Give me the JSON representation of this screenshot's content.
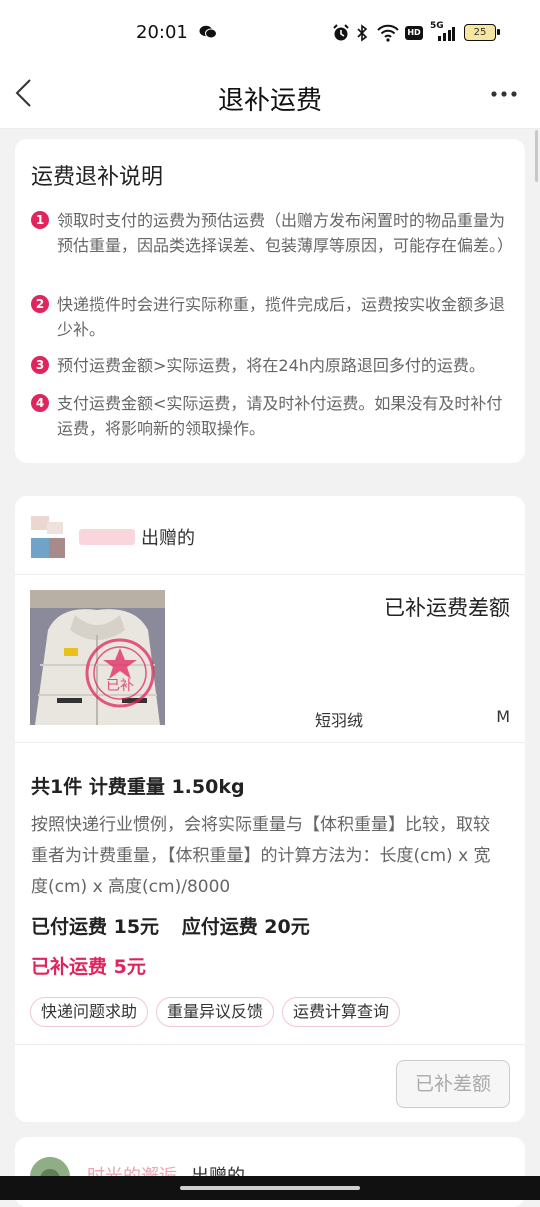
{
  "status_bar": {
    "time": "20:01",
    "network": "5G",
    "hd": "HD",
    "battery": "25",
    "icons": [
      "wechat-icon",
      "alarm-icon",
      "bluetooth-icon",
      "wifi-icon",
      "hd-icon",
      "signal-icon",
      "battery-icon"
    ]
  },
  "nav": {
    "title": "退补运费",
    "back_icon": "chevron-left-icon",
    "more_icon": "more-dots-icon"
  },
  "explain": {
    "title": "运费退补说明",
    "rules": [
      {
        "num": "1",
        "text": "领取时支付的运费为预估运费（出赠方发布闲置时的物品重量为预估重量，因品类选择误差、包装薄厚等原因，可能存在偏差。）"
      },
      {
        "num": "2",
        "text": "快递揽件时会进行实际称重，揽件完成后，运费按实收金额多退少补。"
      },
      {
        "num": "3",
        "text": "预付运费金额>实际运费，将在24h内原路退回多付的运费。"
      },
      {
        "num": "4",
        "text": "支付运费金额<实际运费，请及时补付运费。如果没有及时补付运费，将影响新的领取操作。"
      }
    ]
  },
  "order": {
    "giver_suffix": "出赠的",
    "status": "已补运费差额",
    "stamp_text": "已补",
    "item_name": "短羽绒",
    "item_size": "M",
    "count_weight": "共1件 计费重量 1.50kg",
    "desc": "按照快递行业惯例，会将实际重量与【体积重量】比较，取较重者为计费重量，【体积重量】的计算方法为：长度(cm) x 宽度(cm) x 高度(cm)/8000",
    "paid": "已付运费 15元",
    "due": "应付运费 20元",
    "diff": "已补运费 5元",
    "chips": [
      "快递问题求助",
      "重量异议反馈",
      "运费计算查询"
    ],
    "action": "已补差额"
  },
  "next_order": {
    "giver_name": "时光的邂逅",
    "giver_suffix": "出赠的"
  },
  "colors": {
    "accent": "#e0245e",
    "chip_border": "#f0c8cf",
    "background": "#f2f2f2"
  }
}
